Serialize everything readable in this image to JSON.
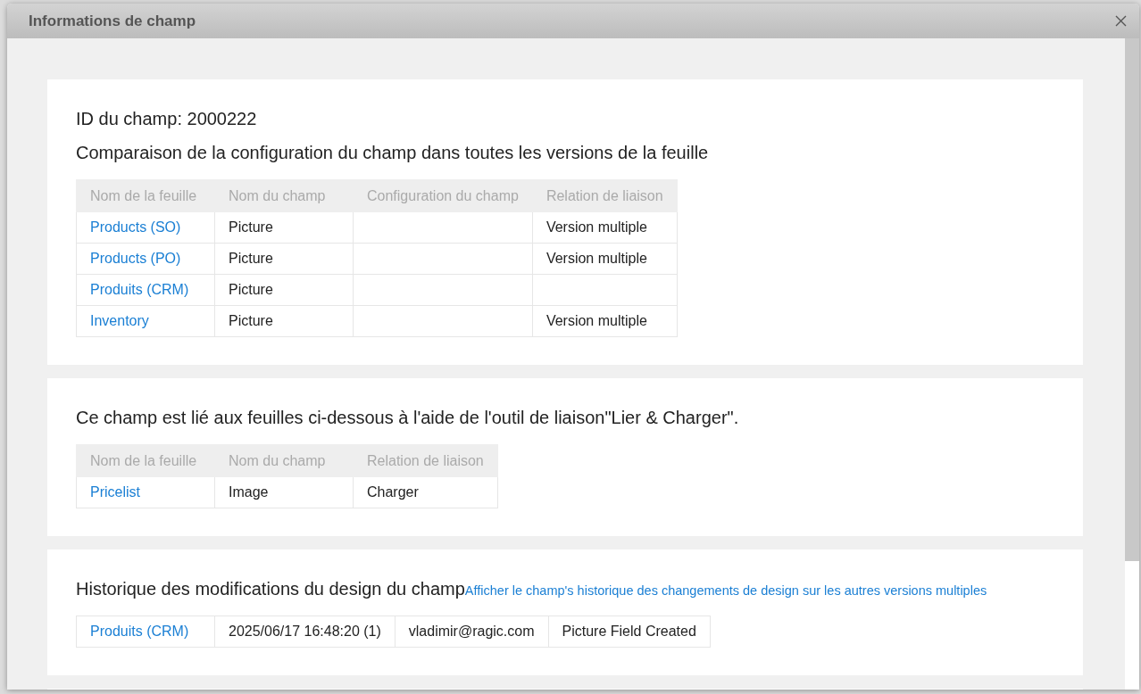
{
  "dialog": {
    "title": "Informations de champ"
  },
  "sections": [
    {
      "lines": [
        "ID du champ: 2000222",
        "Comparaison de la configuration du champ dans toutes les versions de la feuille"
      ],
      "table": {
        "columns": [
          "Nom de la feuille",
          "Nom du champ",
          "Configuration du champ",
          "Relation de liaison"
        ],
        "rows": [
          [
            {
              "kind": "link",
              "text": "Products (SO)"
            },
            {
              "kind": "text",
              "text": "Picture"
            },
            {
              "kind": "empty"
            },
            {
              "kind": "text",
              "text": "Version multiple"
            }
          ],
          [
            {
              "kind": "link",
              "text": "Products (PO)"
            },
            {
              "kind": "text",
              "text": "Picture"
            },
            {
              "kind": "empty"
            },
            {
              "kind": "text",
              "text": "Version multiple"
            }
          ],
          [
            {
              "kind": "link",
              "text": "Produits (CRM)"
            },
            {
              "kind": "text",
              "text": "Picture"
            },
            {
              "kind": "empty"
            },
            {
              "kind": "empty"
            }
          ],
          [
            {
              "kind": "link",
              "text": "Inventory"
            },
            {
              "kind": "text",
              "text": "Picture"
            },
            {
              "kind": "empty"
            },
            {
              "kind": "text",
              "text": "Version multiple"
            }
          ]
        ]
      }
    },
    {
      "lines": [
        "Ce champ est lié aux feuilles ci-dessous à l'aide de l'outil de liaison\"Lier & Charger\"."
      ],
      "table": {
        "columns": [
          "Nom de la feuille",
          "Nom du champ",
          "Relation de liaison"
        ],
        "rows": [
          [
            {
              "kind": "link",
              "text": "Pricelist"
            },
            {
              "kind": "text",
              "text": "Image"
            },
            {
              "kind": "text",
              "text": "Charger"
            }
          ]
        ]
      }
    },
    {
      "lines": [
        "Historique des modifications du design du champ"
      ],
      "link": "Afficher le champ's historique des changements de design sur les autres versions multiples",
      "table": {
        "rows": [
          [
            {
              "kind": "link",
              "text": "Produits (CRM)"
            },
            {
              "kind": "text",
              "text": "2025/06/17 16:48:20 (1)"
            },
            {
              "kind": "text",
              "text": "vladimir@ragic.com"
            },
            {
              "kind": "text",
              "text": "Picture Field Created"
            }
          ]
        ]
      }
    }
  ]
}
